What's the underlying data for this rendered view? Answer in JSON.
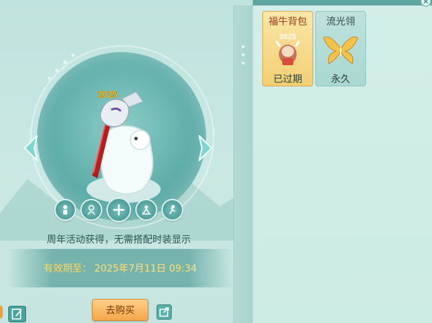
{
  "preview": {
    "year_badge": "2025",
    "description": "周年活动获得，无需搭配时装显示",
    "expire_label": "有效期至：",
    "expire_value": "2025年7月11日 09:34"
  },
  "actions": {
    "buy_label": "去购买"
  },
  "items": [
    {
      "name": "福牛背包",
      "status": "已过期",
      "icon_badge": "2025",
      "icon": "ox-backpack-icon"
    },
    {
      "name": "流光翎",
      "status": "永久",
      "icon": "golden-wings-icon"
    }
  ],
  "colors": {
    "accent": "#5fa6a0",
    "expire_text": "#ffd85a",
    "buy_button": "#f5a64a",
    "selected_card": "#f2cf72"
  }
}
